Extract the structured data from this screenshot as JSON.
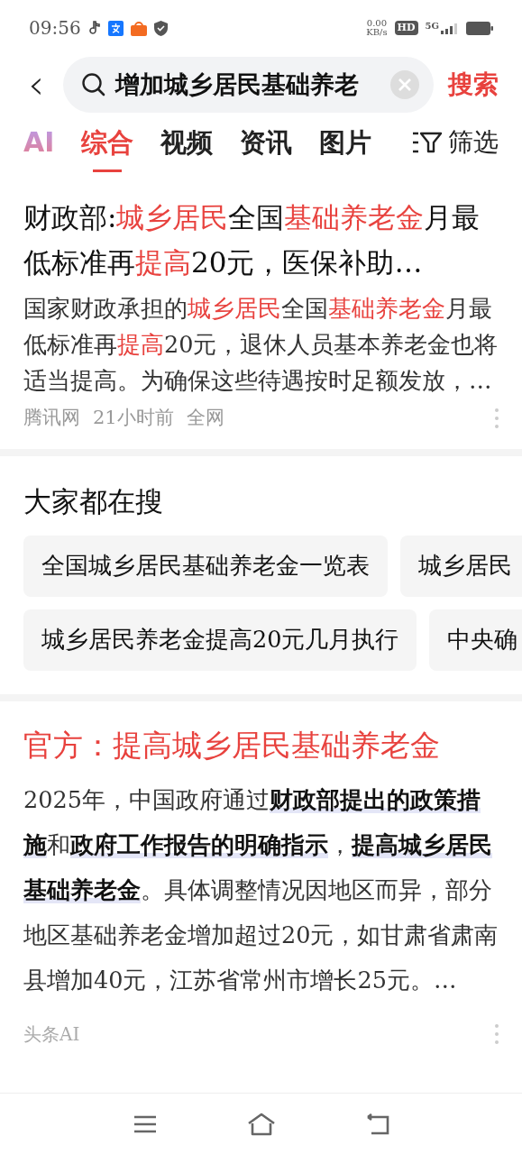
{
  "status_bar": {
    "time": "09:56",
    "net_speed": "0.00",
    "net_unit": "KB/s",
    "hd": "HD",
    "network": "5G"
  },
  "search": {
    "back": "‹",
    "value": "增加城乡居民基础养老",
    "button": "搜索"
  },
  "tabs": [
    {
      "label": "AI",
      "kind": "ai",
      "selected": false
    },
    {
      "label": "综合",
      "kind": "text",
      "selected": true
    },
    {
      "label": "视频",
      "kind": "text",
      "selected": false
    },
    {
      "label": "资讯",
      "kind": "text",
      "selected": false
    },
    {
      "label": "图片",
      "kind": "text",
      "selected": false
    }
  ],
  "filter": {
    "label": "筛选"
  },
  "result_1": {
    "title": [
      {
        "text": "财政部:",
        "highlight": false
      },
      {
        "text": "城乡居民",
        "highlight": true
      },
      {
        "text": "全国",
        "highlight": false
      },
      {
        "text": "基础养老金",
        "highlight": true
      },
      {
        "text": "月最低标准再",
        "highlight": false
      },
      {
        "text": "提高",
        "highlight": true
      },
      {
        "text": "20元，医保补助…",
        "highlight": false
      }
    ],
    "snippet": [
      {
        "text": "国家财政承担的",
        "highlight": false
      },
      {
        "text": "城乡居民",
        "highlight": true
      },
      {
        "text": "全国",
        "highlight": false
      },
      {
        "text": "基础养老金",
        "highlight": true
      },
      {
        "text": "月最低标准再",
        "highlight": false
      },
      {
        "text": "提高",
        "highlight": true
      },
      {
        "text": "20元，退休人员基本养老金也将适当提高。为确保这些待遇按时足额发放，…",
        "highlight": false
      }
    ],
    "meta": [
      "腾讯网",
      "21小时前",
      "全网"
    ]
  },
  "related": {
    "title": "大家都在搜",
    "rows": [
      [
        "全国城乡居民基础养老金一览表",
        "城乡居民"
      ],
      [
        "城乡居民养老金提高20元几月执行",
        "中央确"
      ]
    ]
  },
  "result_2": {
    "title": "官方：提高城乡居民基础养老金",
    "body": "2025年，中国政府通过**财政部提出的政策措施**和**政府工作报告的明确指示**，**提高城乡居民基础养老金**。具体调整情况因地区而异，部分地区基础养老金增加超过20元，如甘肃省肃南县增加40元，江苏省常州市增长25元。…",
    "source": "头条AI"
  }
}
